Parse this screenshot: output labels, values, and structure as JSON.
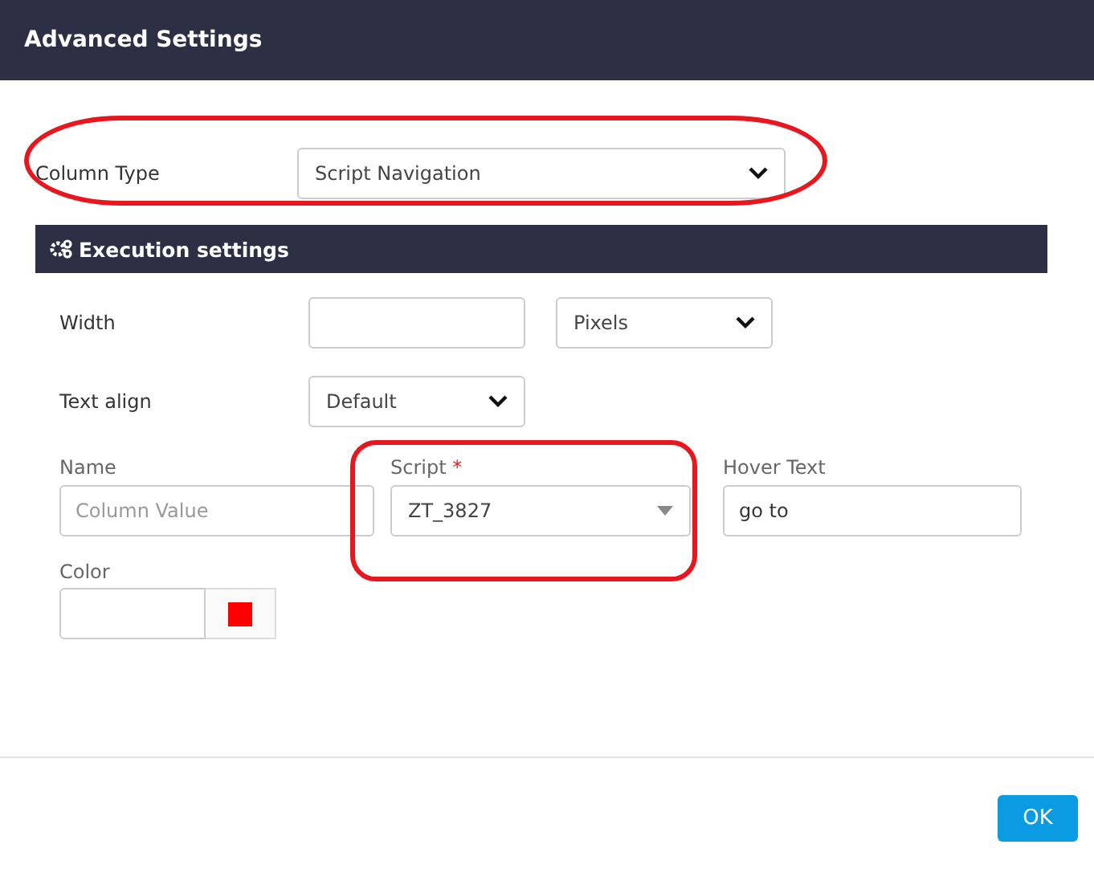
{
  "window": {
    "title": "Advanced Settings"
  },
  "column_type": {
    "label": "Column Type",
    "value": "Script Navigation",
    "highlighted": true
  },
  "section": {
    "title": "Execution settings"
  },
  "width": {
    "label": "Width",
    "value_unit": "Pixels"
  },
  "text_align": {
    "label": "Text align",
    "value": "Default"
  },
  "name": {
    "label": "Name",
    "placeholder": "Column Value"
  },
  "script": {
    "label": "Script",
    "required_mark": "*",
    "value": "ZT_3827",
    "highlighted": true
  },
  "hover_text": {
    "label": "Hover Text",
    "value": "go to"
  },
  "color": {
    "label": "Color",
    "color": "#ff0000"
  },
  "buttons": [
    "OK"
  ]
}
